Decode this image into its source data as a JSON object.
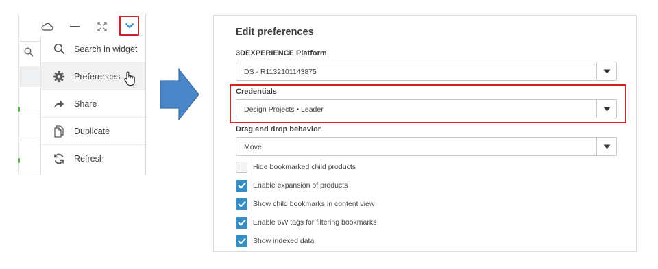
{
  "widget_menu": {
    "items": [
      {
        "label": "Search in widget",
        "icon": "search-icon"
      },
      {
        "label": "Preferences",
        "icon": "gear-icon"
      },
      {
        "label": "Share",
        "icon": "share-icon"
      },
      {
        "label": "Duplicate",
        "icon": "duplicate-icon"
      },
      {
        "label": "Refresh",
        "icon": "refresh-icon"
      }
    ],
    "toolbar_icons": [
      "cloud-icon",
      "minimize-icon",
      "expand-icon",
      "chevron-down-icon"
    ]
  },
  "preferences": {
    "title": "Edit preferences",
    "fields": [
      {
        "label": "3DEXPERIENCE Platform",
        "value": "DS - R1132101143875"
      },
      {
        "label": "Credentials",
        "value": "Design Projects • Leader"
      },
      {
        "label": "Drag and drop behavior",
        "value": "Move"
      }
    ],
    "checkboxes": [
      {
        "label": "Hide bookmarked child products",
        "checked": false
      },
      {
        "label": "Enable expansion of products",
        "checked": true
      },
      {
        "label": "Show child bookmarks in content view",
        "checked": true
      },
      {
        "label": "Enable 6W tags for filtering bookmarks",
        "checked": true
      },
      {
        "label": "Show indexed data",
        "checked": true
      }
    ]
  },
  "colors": {
    "highlight": "#d0232c",
    "checkbox_on": "#368ec4",
    "arrow": "#4a86c8",
    "accent_chevron": "#1f8ad8"
  }
}
